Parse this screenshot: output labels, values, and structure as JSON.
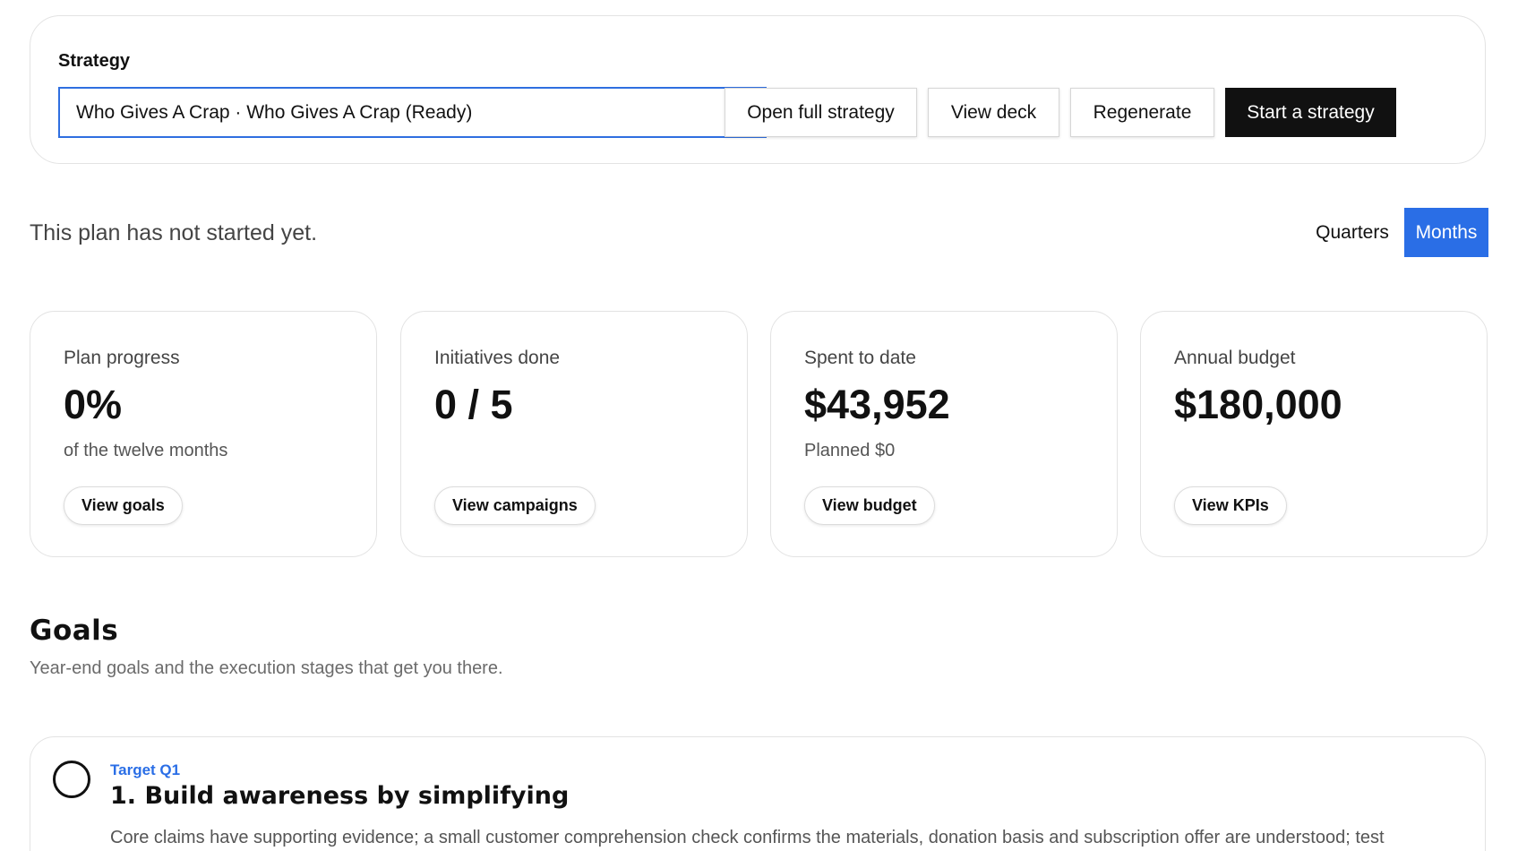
{
  "strategy": {
    "label": "Strategy",
    "selected": "Who Gives A Crap · Who Gives A Crap (Ready)",
    "buttons": {
      "open_full": "Open full strategy",
      "view_deck": "View deck",
      "regenerate": "Regenerate",
      "start": "Start a strategy"
    }
  },
  "plan": {
    "status": "This plan has not started yet.",
    "view_toggle": {
      "quarters": "Quarters",
      "months": "Months",
      "active": "Months"
    }
  },
  "stats": [
    {
      "label": "Plan progress",
      "value": "0%",
      "sub": "of the twelve months",
      "button": "View goals"
    },
    {
      "label": "Initiatives done",
      "value": "0 / 5",
      "sub": "",
      "button": "View campaigns"
    },
    {
      "label": "Spent to date",
      "value": "$43,952",
      "sub": "Planned $0",
      "button": "View budget"
    },
    {
      "label": "Annual budget",
      "value": "$180,000",
      "sub": "",
      "button": "View KPIs"
    }
  ],
  "goals": {
    "title": "Goals",
    "subtitle": "Year-end goals and the execution stages that get you there.",
    "items": [
      {
        "target": "Target Q1",
        "title": "1. Build awareness by simplifying",
        "description": "Core claims have supporting evidence; a small customer comprehension check confirms the materials, donation basis and subscription offer are understood; test"
      }
    ]
  },
  "colors": {
    "accent": "#2a6ee6",
    "primary_dark": "#111111",
    "border": "#e3e3e3"
  }
}
